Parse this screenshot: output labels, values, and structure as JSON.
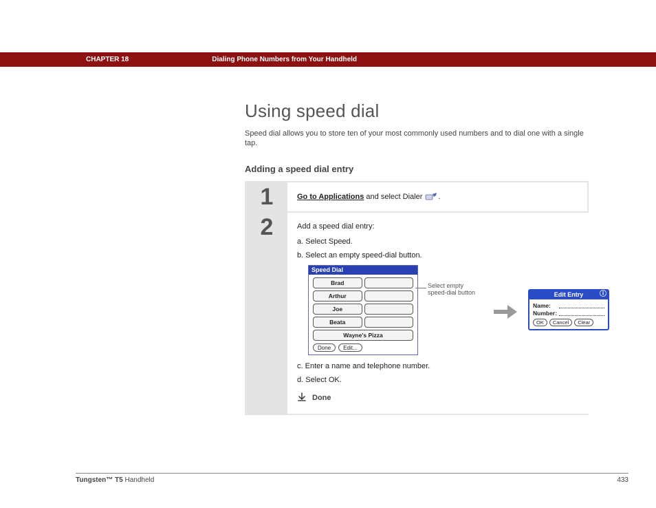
{
  "header": {
    "chapter_label": "CHAPTER 18",
    "chapter_title": "Dialing Phone Numbers from Your Handheld"
  },
  "main": {
    "heading": "Using speed dial",
    "intro": "Speed dial allows you to store ten of your most commonly used numbers and to dial one with a single tap.",
    "subheading": "Adding a speed dial entry"
  },
  "steps": [
    {
      "num": "1",
      "link_text": "Go to Applications",
      "after_link": " and select Dialer ",
      "after_icon": "."
    },
    {
      "num": "2",
      "lead": "Add a speed dial entry:",
      "items": [
        "a.   Select Speed.",
        "b.   Select an empty speed-dial button.",
        "c.   Enter a name and telephone number.",
        "d.   Select OK."
      ],
      "done": "Done"
    }
  ],
  "speed_dial_panel": {
    "title": "Speed Dial",
    "entries": [
      "Brad",
      "Arthur",
      "Joe",
      "Beata",
      "Wayne's Pizza"
    ],
    "buttons": [
      "Done",
      "Edit..."
    ]
  },
  "callout": "Select empty speed-dial button",
  "edit_panel": {
    "title": "Edit Entry",
    "name_label": "Name:",
    "number_label": "Number:",
    "buttons": [
      "OK",
      "Cancel",
      "Clear"
    ]
  },
  "footer": {
    "product_bold": "Tungsten™ T5",
    "product_rest": " Handheld",
    "page": "433"
  }
}
